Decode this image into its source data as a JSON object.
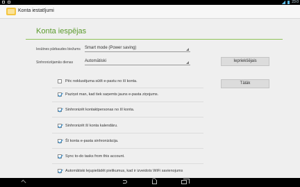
{
  "status_bar": {
    "time": "23:0"
  },
  "action_bar": {
    "title": "Konta iestatījumi"
  },
  "page": {
    "heading": "Konta iespējas"
  },
  "settings": {
    "check_frequency": {
      "label": "Iesūtnes pārbaudes biežums",
      "value": "Smart mode (Power saving)"
    },
    "sync_days": {
      "label": "Sinhronizējamās dienas",
      "value": "Automātiski"
    }
  },
  "buttons": {
    "previous": "Iepriekšējais",
    "next": "Tālāk"
  },
  "checkboxes": [
    {
      "label": "Pēc noklusējuma sūtīt e-pastu no šī konta.",
      "checked": false
    },
    {
      "label": "Paziņot man, kad tiek saņemts jauns e-pasta ziņojums.",
      "checked": true
    },
    {
      "label": "Sinhronizēt kontaktpersonas no šī konta.",
      "checked": true
    },
    {
      "label": "Sinhronizēt šī konta kalendāru.",
      "checked": true
    },
    {
      "label": "Šī konta e-pasta sinhronizācija.",
      "checked": true
    },
    {
      "label": "Sync to-do tasks from this account.",
      "checked": true
    },
    {
      "label": "Automātiski lejupielādēt pielikumus, kad ir izveidots WiFi savienojums",
      "checked": true
    }
  ]
}
